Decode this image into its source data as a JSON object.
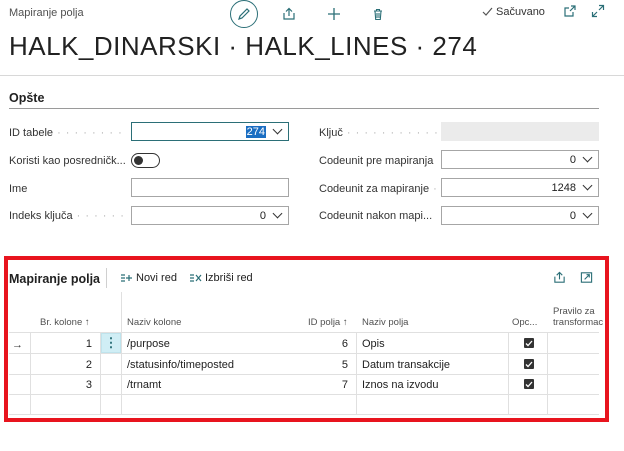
{
  "header": {
    "breadcrumb": "Mapiranje polja",
    "title": "HALK_DINARSKI · HALK_LINES · 274",
    "saved_label": "Sačuvano",
    "icons": [
      "edit-icon",
      "share-icon",
      "add-icon",
      "delete-icon",
      "open-new-window-icon",
      "expand-icon"
    ]
  },
  "general": {
    "section_title": "Opšte",
    "fields": {
      "table_id": {
        "label": "ID tabele",
        "value": "274"
      },
      "use_staging": {
        "label": "Koristi kao posredničk...",
        "value": false
      },
      "name": {
        "label": "Ime",
        "value": ""
      },
      "key_index": {
        "label": "Indeks ključa",
        "value": "0"
      },
      "key": {
        "label": "Ključ",
        "value": ""
      },
      "codeunit_pre": {
        "label": "Codeunit pre mapiranja",
        "value": "0"
      },
      "codeunit_for": {
        "label": "Codeunit za mapiranje",
        "value": "1248"
      },
      "codeunit_after": {
        "label": "Codeunit nakon mapi...",
        "value": "0"
      }
    }
  },
  "lines": {
    "title": "Mapiranje polja",
    "actions": {
      "new_row": "Novi red",
      "delete_row": "Izbriši red"
    },
    "columns": {
      "column_no": "Br. kolone ↑",
      "column_name": "Naziv kolone",
      "field_id": "ID polja ↑",
      "field_name": "Naziv polja",
      "optional": "Opc...",
      "transform_rule": "Pravilo za transformac"
    },
    "rows": [
      {
        "column_no": "1",
        "column_name": "/purpose",
        "field_id": "6",
        "field_name": "Opis",
        "optional": true
      },
      {
        "column_no": "2",
        "column_name": "/statusinfo/timeposted",
        "field_id": "5",
        "field_name": "Datum transakcije",
        "optional": true
      },
      {
        "column_no": "3",
        "column_name": "/trnamt",
        "field_id": "7",
        "field_name": "Iznos na izvodu",
        "optional": true
      }
    ]
  },
  "colors": {
    "accent": "#2b6f77",
    "highlight": "#e8141e",
    "selection": "#1b6ec2"
  }
}
